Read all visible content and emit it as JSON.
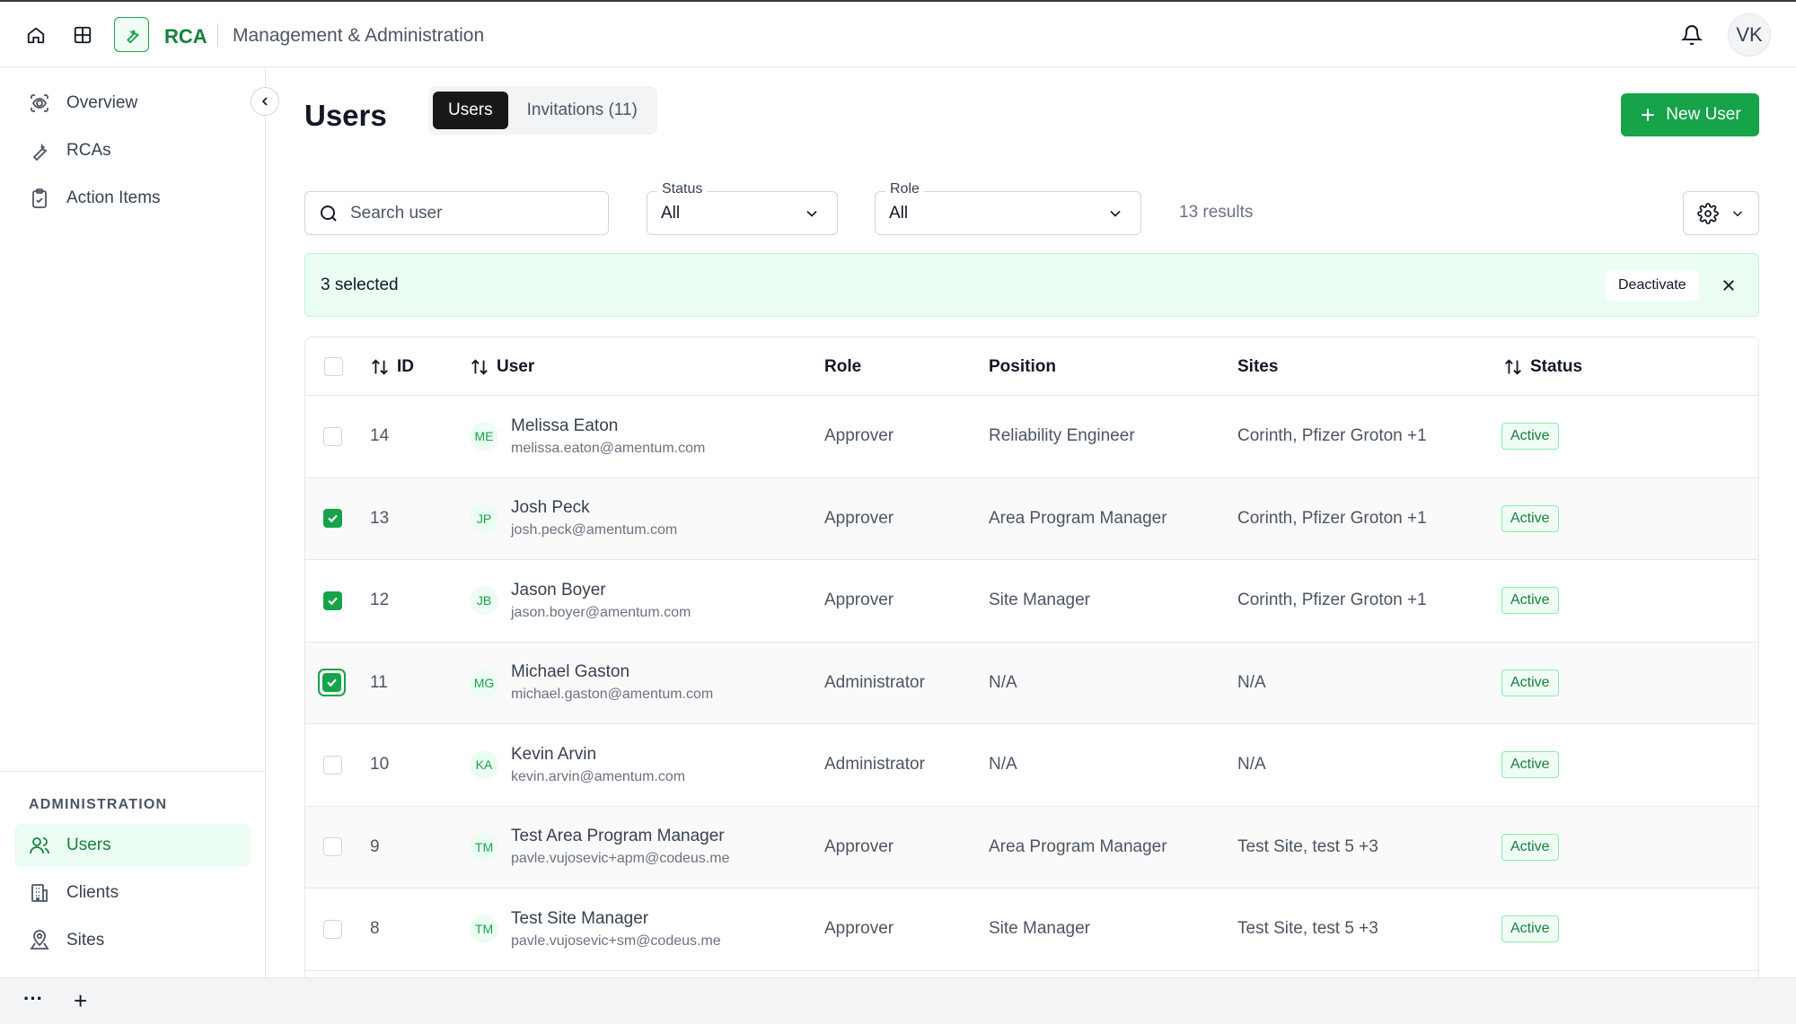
{
  "topbar": {
    "brand": "RCA",
    "title": "Management & Administration",
    "avatar_initials": "VK"
  },
  "sidebar": {
    "items": [
      {
        "label": "Overview",
        "icon": "overview-icon"
      },
      {
        "label": "RCAs",
        "icon": "wrench-icon"
      },
      {
        "label": "Action Items",
        "icon": "clipboard-icon"
      }
    ],
    "section_label": "ADMINISTRATION",
    "admin_items": [
      {
        "label": "Users",
        "icon": "users-icon",
        "active": true
      },
      {
        "label": "Clients",
        "icon": "building-icon"
      },
      {
        "label": "Sites",
        "icon": "location-icon"
      }
    ]
  },
  "page": {
    "title": "Users",
    "tabs": [
      {
        "label": "Users",
        "active": true
      },
      {
        "label": "Invitations (11)",
        "active": false
      }
    ],
    "new_user_label": "New User"
  },
  "filters": {
    "search_placeholder": "Search user",
    "status": {
      "label": "Status",
      "value": "All"
    },
    "role": {
      "label": "Role",
      "value": "All"
    },
    "results": "13 results"
  },
  "selection": {
    "count_text": "3 selected",
    "deactivate_label": "Deactivate"
  },
  "table": {
    "headers": {
      "id": "ID",
      "user": "User",
      "role": "Role",
      "position": "Position",
      "sites": "Sites",
      "status": "Status"
    },
    "rows": [
      {
        "id": "14",
        "initials": "ME",
        "name": "Melissa Eaton",
        "email": "melissa.eaton@amentum.com",
        "role": "Approver",
        "position": "Reliability Engineer",
        "sites": "Corinth, Pfizer Groton +1",
        "status": "Active",
        "checked": false
      },
      {
        "id": "13",
        "initials": "JP",
        "name": "Josh Peck",
        "email": "josh.peck@amentum.com",
        "role": "Approver",
        "position": "Area Program Manager",
        "sites": "Corinth, Pfizer Groton +1",
        "status": "Active",
        "checked": true
      },
      {
        "id": "12",
        "initials": "JB",
        "name": "Jason Boyer",
        "email": "jason.boyer@amentum.com",
        "role": "Approver",
        "position": "Site Manager",
        "sites": "Corinth, Pfizer Groton +1",
        "status": "Active",
        "checked": true
      },
      {
        "id": "11",
        "initials": "MG",
        "name": "Michael Gaston",
        "email": "michael.gaston@amentum.com",
        "role": "Administrator",
        "position": "N/A",
        "sites": "N/A",
        "status": "Active",
        "checked": true,
        "focused": true
      },
      {
        "id": "10",
        "initials": "KA",
        "name": "Kevin Arvin",
        "email": "kevin.arvin@amentum.com",
        "role": "Administrator",
        "position": "N/A",
        "sites": "N/A",
        "status": "Active",
        "checked": false
      },
      {
        "id": "9",
        "initials": "TM",
        "name": "Test Area Program Manager",
        "email": "pavle.vujosevic+apm@codeus.me",
        "role": "Approver",
        "position": "Area Program Manager",
        "sites": "Test Site, test 5 +3",
        "status": "Active",
        "checked": false
      },
      {
        "id": "8",
        "initials": "TM",
        "name": "Test Site Manager",
        "email": "pavle.vujosevic+sm@codeus.me",
        "role": "Approver",
        "position": "Site Manager",
        "sites": "Test Site, test 5 +3",
        "status": "Active",
        "checked": false
      }
    ]
  },
  "bottombar": {
    "more_glyph": "···",
    "add_glyph": "+"
  },
  "colors": {
    "accent": "#16a34a",
    "accent_light": "#ecfdf3",
    "dark_tab": "#18181b"
  }
}
